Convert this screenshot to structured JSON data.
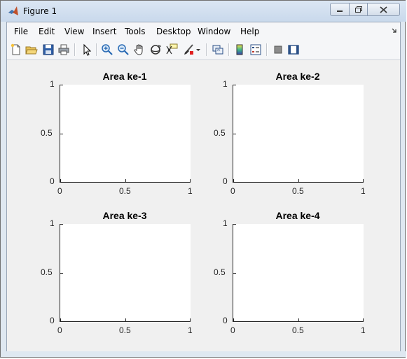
{
  "window": {
    "title": "Figure 1",
    "icon": "matlab-logo-icon",
    "controls": [
      "minimize-icon",
      "restore-icon",
      "close-icon"
    ]
  },
  "menubar": {
    "items": [
      "File",
      "Edit",
      "View",
      "Insert",
      "Tools",
      "Desktop",
      "Window",
      "Help"
    ]
  },
  "toolbar": {
    "buttons": [
      "new-figure-icon",
      "open-file-icon",
      "save-icon",
      "print-icon",
      "edit-plot-arrow-icon",
      "zoom-in-icon",
      "zoom-out-icon",
      "pan-hand-icon",
      "rotate-3d-icon",
      "data-cursor-icon",
      "brush-icon",
      "brush-dropdown-icon",
      "link-plot-icon",
      "insert-colorbar-icon",
      "insert-legend-icon",
      "hide-plot-tools-icon",
      "show-plot-tools-icon"
    ]
  },
  "colors": {
    "title_bar": "#c9d9ec",
    "figure_background": "#f0f0f0",
    "axes_background": "#ffffff",
    "axis_color": "#262626"
  },
  "chart_data": [
    {
      "type": "line",
      "title": "Area ke-1",
      "xlim": [
        0,
        1
      ],
      "ylim": [
        0,
        1
      ],
      "xticks": [
        "0",
        "0.5",
        "1"
      ],
      "yticks": [
        "0",
        "0.5",
        "1"
      ],
      "series": []
    },
    {
      "type": "line",
      "title": "Area ke-2",
      "xlim": [
        0,
        1
      ],
      "ylim": [
        0,
        1
      ],
      "xticks": [
        "0",
        "0.5",
        "1"
      ],
      "yticks": [
        "0",
        "0.5",
        "1"
      ],
      "series": []
    },
    {
      "type": "line",
      "title": "Area ke-3",
      "xlim": [
        0,
        1
      ],
      "ylim": [
        0,
        1
      ],
      "xticks": [
        "0",
        "0.5",
        "1"
      ],
      "yticks": [
        "0",
        "0.5",
        "1"
      ],
      "series": []
    },
    {
      "type": "line",
      "title": "Area ke-4",
      "xlim": [
        0,
        1
      ],
      "ylim": [
        0,
        1
      ],
      "xticks": [
        "0",
        "0.5",
        "1"
      ],
      "yticks": [
        "0",
        "0.5",
        "1"
      ],
      "series": []
    }
  ]
}
